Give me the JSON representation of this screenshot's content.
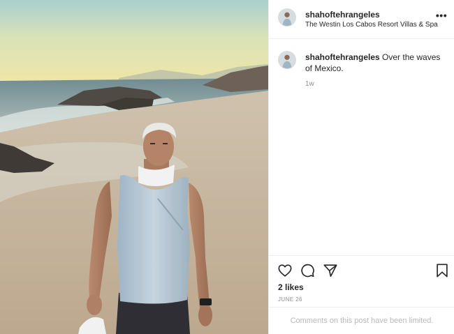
{
  "post": {
    "image_alt": "Man in a light tank top standing on a beach at sunset"
  },
  "header": {
    "username": "shahoftehrangeles",
    "location": "The Westin Los Cabos Resort Villas & Spa",
    "more_label": "•••",
    "avatar_icon": "profile-avatar-icon"
  },
  "caption": {
    "username": "shahoftehrangeles",
    "text": " Over the waves of Mexico.",
    "time": "1w"
  },
  "actions": {
    "like_icon": "heart-icon",
    "comment_icon": "comment-bubble-icon",
    "share_icon": "paper-plane-icon",
    "save_icon": "bookmark-icon"
  },
  "stats": {
    "likes": "2 likes",
    "date": "JUNE 26"
  },
  "footer": {
    "comments_limited": "Comments on this post have been limited."
  },
  "colors": {
    "text": "#262626",
    "muted": "#8e8e8e",
    "divider": "#efefef"
  }
}
